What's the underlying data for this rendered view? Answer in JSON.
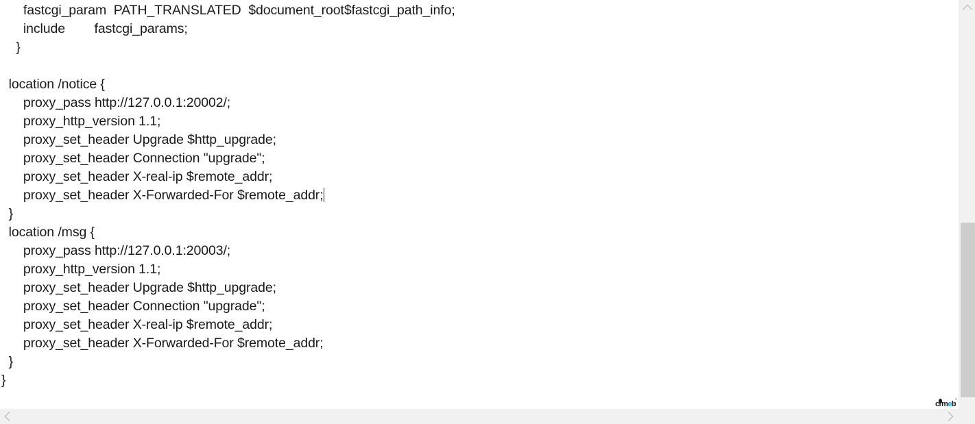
{
  "editor": {
    "language": "nginx-conf",
    "caret_line_index": 10,
    "lines": [
      "      fastcgi_param  PATH_TRANSLATED  $document_root$fastcgi_path_info;",
      "      include        fastcgi_params;",
      "    }",
      "",
      "  location /notice {",
      "      proxy_pass http://127.0.0.1:20002/;",
      "      proxy_http_version 1.1;",
      "      proxy_set_header Upgrade $http_upgrade;",
      "      proxy_set_header Connection \"upgrade\";",
      "      proxy_set_header X-real-ip $remote_addr;",
      "      proxy_set_header X-Forwarded-For $remote_addr;",
      "  }",
      "  location /msg {",
      "      proxy_pass http://127.0.0.1:20003/;",
      "      proxy_http_version 1.1;",
      "      proxy_set_header Upgrade $http_upgrade;",
      "      proxy_set_header Connection \"upgrade\";",
      "      proxy_set_header X-real-ip $remote_addr;",
      "      proxy_set_header X-Forwarded-For $remote_addr;",
      "  }",
      "}"
    ]
  },
  "watermark": {
    "text_before": "crm",
    "text_accent": "e",
    "text_after": "b",
    "accent_color": "#00a8e8"
  },
  "scrollbars": {
    "vertical": {
      "up_arrow_icon": "chevron-up-icon",
      "down_arrow_icon": "chevron-down-icon",
      "thumb_color": "#cdcdcd",
      "track_color": "#f1f1f1"
    },
    "horizontal": {
      "left_arrow_icon": "chevron-left-icon",
      "right_arrow_icon": "chevron-right-icon",
      "track_color": "#f1f1f1"
    }
  }
}
